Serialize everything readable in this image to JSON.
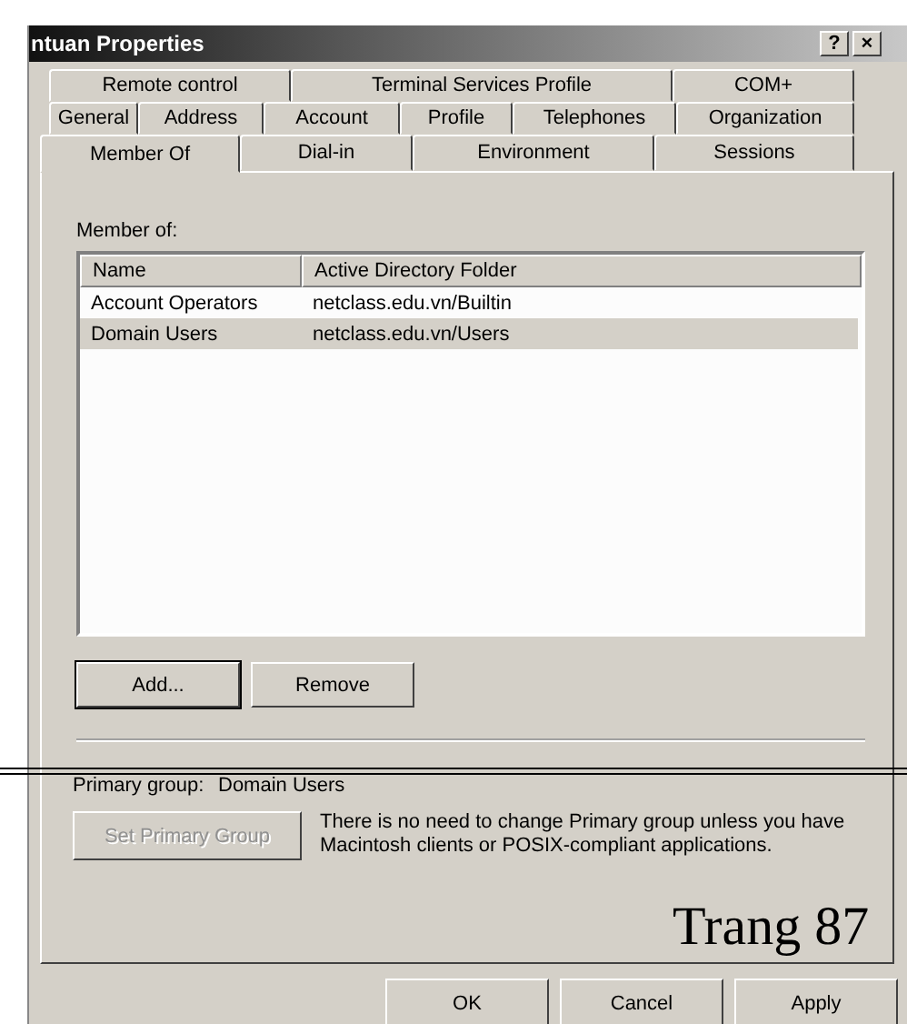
{
  "window": {
    "title": "ntuan Properties",
    "controls": [
      "?",
      "×"
    ]
  },
  "tab_rows": [
    [
      {
        "label": "Remote control",
        "selected": false
      },
      {
        "label": "Terminal Services Profile",
        "selected": false
      },
      {
        "label": "COM+",
        "selected": false
      }
    ],
    [
      {
        "label": "General",
        "selected": false
      },
      {
        "label": "Address",
        "selected": false
      },
      {
        "label": "Account",
        "selected": false
      },
      {
        "label": "Profile",
        "selected": false
      },
      {
        "label": "Telephones",
        "selected": false
      },
      {
        "label": "Organization",
        "selected": false
      }
    ],
    [
      {
        "label": "Member Of",
        "selected": true
      },
      {
        "label": "Dial-in",
        "selected": false
      },
      {
        "label": "Environment",
        "selected": false
      },
      {
        "label": "Sessions",
        "selected": false
      }
    ]
  ],
  "member_of": {
    "label": "Member of:",
    "columns": [
      "Name",
      "Active Directory Folder"
    ],
    "rows": [
      {
        "cells": [
          "Account Operators",
          "netclass.edu.vn/Builtin"
        ],
        "selected": false
      },
      {
        "cells": [
          "Domain Users",
          "netclass.edu.vn/Users"
        ],
        "selected": true
      }
    ]
  },
  "list_buttons": [
    {
      "label": "Add...",
      "disabled": false,
      "focused": true
    },
    {
      "label": "Remove",
      "disabled": false,
      "focused": false
    }
  ],
  "primary_group": {
    "label": "Primary group:",
    "value": "Domain Users"
  },
  "set_primary_button": {
    "label": "Set Primary Group",
    "disabled": true
  },
  "note": "There is no need to change Primary group unless you have Macintosh clients or POSIX-compliant applications.",
  "dialog_buttons": [
    {
      "label": "OK",
      "disabled": false
    },
    {
      "label": "Cancel",
      "disabled": false
    },
    {
      "label": "Apply",
      "disabled": false
    }
  ],
  "page_number": "Trang 87"
}
